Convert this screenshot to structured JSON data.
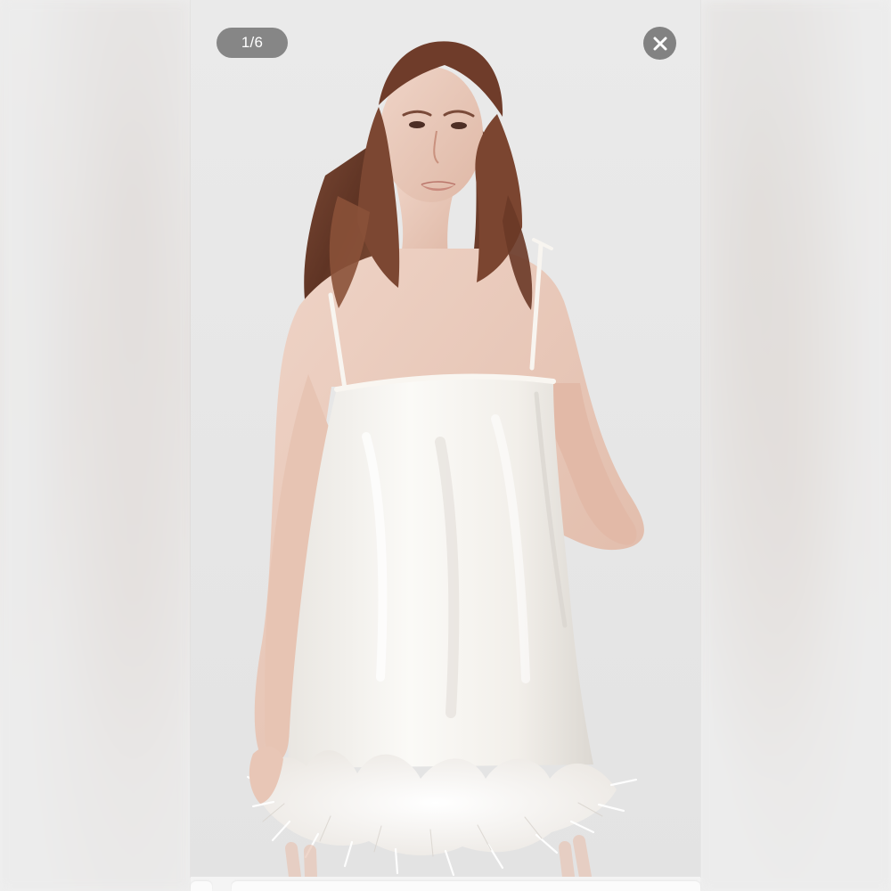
{
  "viewer": {
    "counter": "1/6",
    "close_icon": "close-icon",
    "image_subject": "product-photo"
  },
  "colors": {
    "overlay": "#707070",
    "background": "#efefef",
    "dress": "#f7f5f1"
  }
}
